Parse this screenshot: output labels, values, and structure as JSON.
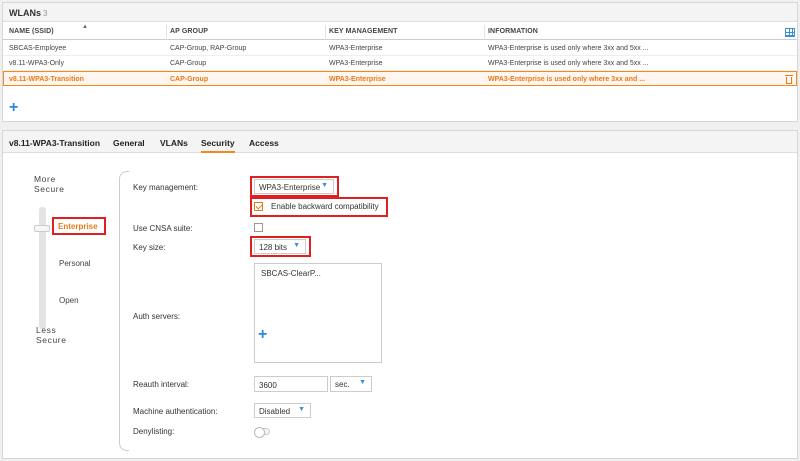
{
  "wlans": {
    "title": "WLANs",
    "count": "3",
    "columns": [
      "NAME (SSID)",
      "AP GROUP",
      "KEY MANAGEMENT",
      "INFORMATION"
    ],
    "rows": [
      [
        "SBCAS-Employee",
        "CAP-Group, RAP-Group",
        "WPA3-Enterprise",
        "WPA3-Enterprise is used only where 3xx and 5xx ..."
      ],
      [
        "v8.11-WPA3-Only",
        "CAP-Group",
        "WPA3-Enterprise",
        "WPA3-Enterprise is used only where 3xx and 5xx ..."
      ],
      [
        "v8.11-WPA3-Transition",
        "CAP-Group",
        "WPA3-Enterprise",
        "WPA3-Enterprise is used only where 3xx and ..."
      ]
    ],
    "selected_row": 2,
    "add_label": "+"
  },
  "detail": {
    "ssid": "v8.11-WPA3-Transition",
    "tabs": [
      "General",
      "VLANs",
      "Security",
      "Access"
    ],
    "active_tab": "Security"
  },
  "security_levels": {
    "more_secure": [
      "More",
      "Secure"
    ],
    "less_secure": [
      "Less",
      "Secure"
    ],
    "levels": [
      "Enterprise",
      "Personal",
      "Open"
    ],
    "active": "Enterprise"
  },
  "form": {
    "key_management_label": "Key management:",
    "key_management_value": "WPA3-Enterprise",
    "backward_compat_label": "Enable backward compatibility",
    "backward_compat_checked": true,
    "cnsa_label": "Use CNSA suite:",
    "cnsa_checked": false,
    "key_size_label": "Key size:",
    "key_size_value": "128 bits",
    "auth_servers_label": "Auth servers:",
    "auth_servers": [
      "SBCAS-ClearP..."
    ],
    "auth_add": "+",
    "reauth_label": "Reauth interval:",
    "reauth_value": "3600",
    "reauth_unit": "sec.",
    "machine_auth_label": "Machine authentication:",
    "machine_auth_value": "Disabled",
    "denylisting_label": "Denylisting:",
    "denylisting_on": false
  },
  "colors": {
    "accent": "#f28a1e",
    "highlight": "#e02020",
    "link": "#2b8be0"
  }
}
